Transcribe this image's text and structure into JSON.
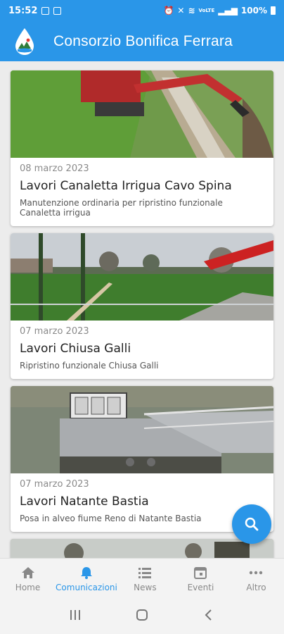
{
  "status_bar": {
    "time": "15:52",
    "battery": "100%",
    "signal_text": "VoLTE"
  },
  "app_bar": {
    "title": "Consorzio Bonifica Ferrara"
  },
  "cards": [
    {
      "date": "08 marzo 2023",
      "title": "Lavori Canaletta Irrigua Cavo Spina",
      "description": "Manutenzione ordinaria per ripristino funzionale Canaletta irrigua"
    },
    {
      "date": "07 marzo 2023",
      "title": "Lavori Chiusa Galli",
      "description": "Ripristino funzionale Chiusa Galli"
    },
    {
      "date": "07 marzo 2023",
      "title": "Lavori Natante Bastia",
      "description": "Posa in alveo fiume Reno di Natante Bastia"
    }
  ],
  "nav": {
    "items": [
      {
        "label": "Home",
        "icon": "home-icon"
      },
      {
        "label": "Comunicazioni",
        "icon": "bell-icon"
      },
      {
        "label": "News",
        "icon": "list-icon"
      },
      {
        "label": "Eventi",
        "icon": "calendar-icon"
      },
      {
        "label": "Altro",
        "icon": "more-icon"
      }
    ],
    "active_index": 1
  },
  "colors": {
    "primary": "#2a96e8",
    "inactive": "#888888"
  }
}
